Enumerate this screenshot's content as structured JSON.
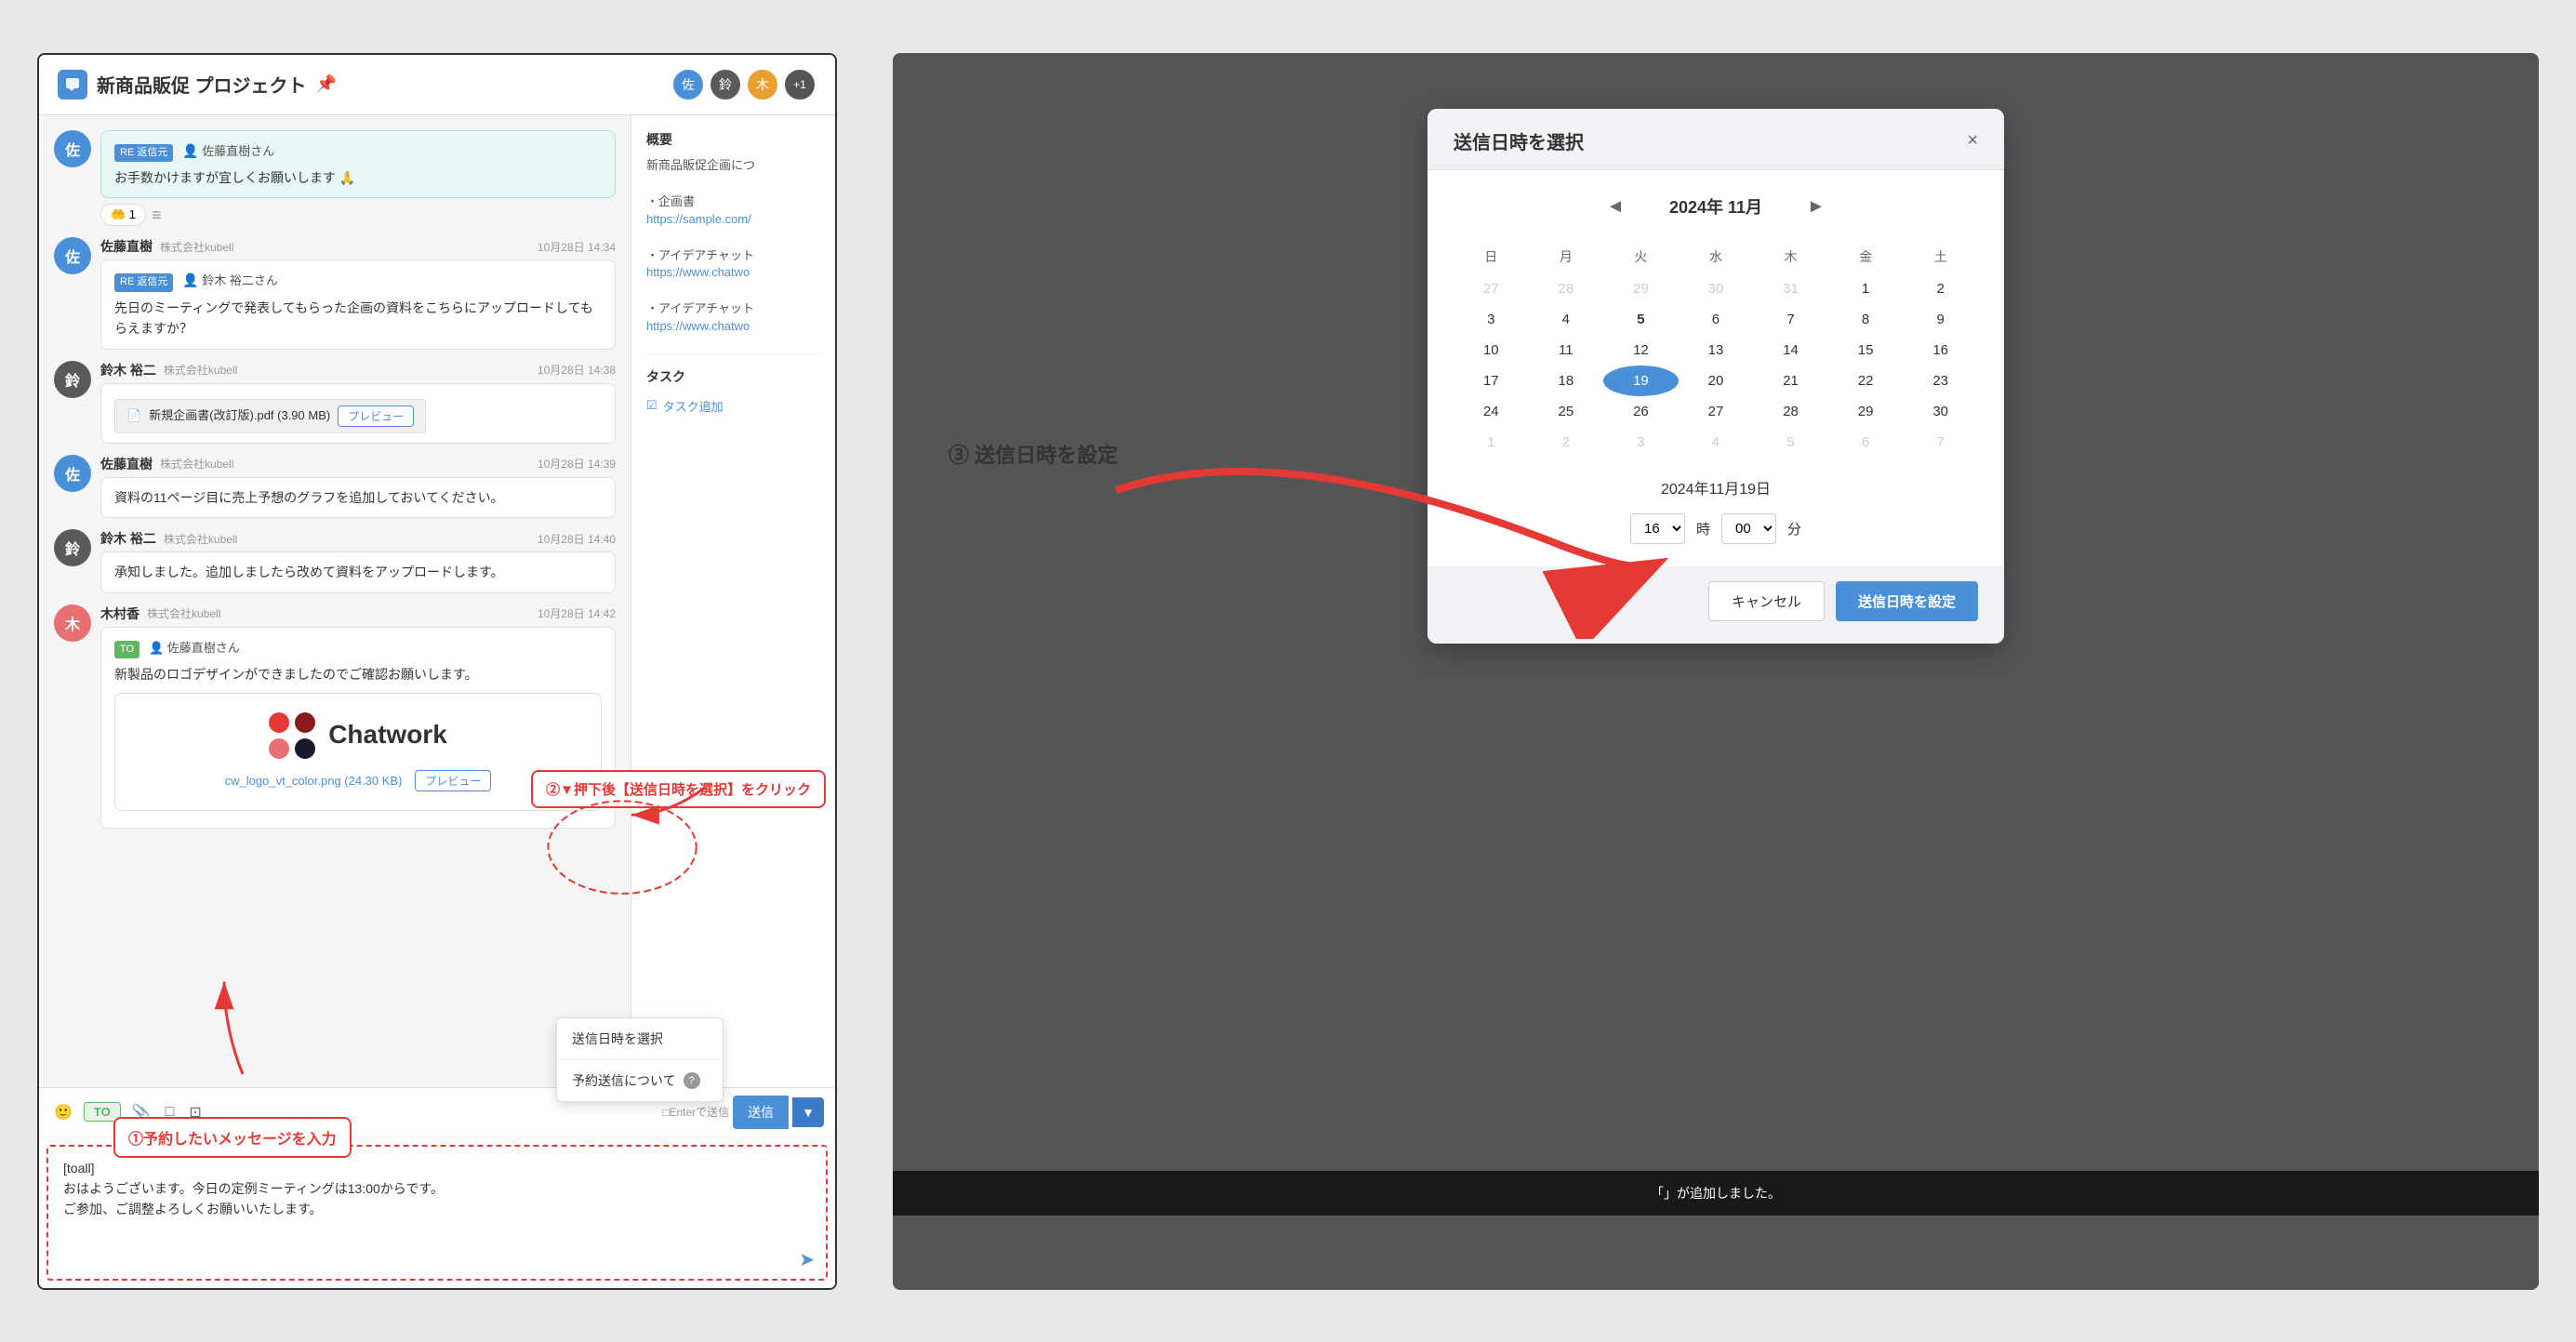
{
  "chat": {
    "title": "新商品販促 プロジェクト",
    "pin_symbol": "📌",
    "messages": [
      {
        "id": "msg1",
        "avatar_color": "#4a90d9",
        "avatar_text": "佐",
        "name": "佐藤直樹",
        "company": "株式会社kubell",
        "time": "",
        "re_tag": "RE 返信元",
        "re_person": "佐藤直樹さん",
        "body": "お手数かけますが宜しくお願いします 🙏",
        "has_reaction": true,
        "reaction_emoji": "🤲",
        "reaction_count": "1"
      },
      {
        "id": "msg2",
        "avatar_color": "#4a90d9",
        "avatar_text": "佐",
        "name": "佐藤直樹",
        "company": "株式会社kubell",
        "time": "10月28日 14:34",
        "re_tag": "RE 返信元",
        "re_person": "鈴木 裕二さん",
        "body": "先日のミーティングで発表してもらった企画の資料をこちらにアップロードしてもらえますか？"
      },
      {
        "id": "msg3",
        "avatar_color": "#5a5a5a",
        "avatar_text": "鈴",
        "name": "鈴木 裕二",
        "company": "株式会社kubell",
        "time": "10月28日 14:38",
        "body": "",
        "has_file": true,
        "file_name": "新規企画書(改訂版).pdf (3.90 MB)"
      },
      {
        "id": "msg4",
        "avatar_color": "#4a90d9",
        "avatar_text": "佐",
        "name": "佐藤直樹",
        "company": "株式会社kubell",
        "time": "10月28日 14:39",
        "body": "資料の11ページ目に売上予想のグラフを追加しておいてください。"
      },
      {
        "id": "msg5",
        "avatar_color": "#5a5a5a",
        "avatar_text": "鈴",
        "name": "鈴木 裕二",
        "company": "株式会社kubell",
        "time": "10月28日 14:40",
        "body": "承知しました。追加しましたら改めて資料をアップロードします。"
      },
      {
        "id": "msg6",
        "avatar_color": "#e87070",
        "avatar_text": "木",
        "name": "木村香",
        "company": "株式会社kubell",
        "time": "10月28日 14:42",
        "to_tag": "TO",
        "to_person": "佐藤直樹さん",
        "body": "新製品のロゴデザインができましたのでご確認お願いします。",
        "has_logo_card": true
      }
    ],
    "sidebar": {
      "overview_title": "概要",
      "overview_text": "新商品販促企画につ",
      "doc_title": "・企画書",
      "doc_link": "https://sample.com/",
      "idea_chat1_title": "・アイデアチャット",
      "idea_chat1_link": "https://www.chatwo",
      "idea_chat2_title": "・アイデアチャット",
      "idea_chat2_link": "https://www.chatwo",
      "task_title": "タスク",
      "task_add": "タスク追加"
    },
    "input": {
      "to_label": "TO",
      "send_label": "送信",
      "enter_label": "□Enterで送信",
      "textarea_value": "[toall]\nおはようございます。今日の定例ミーティングは13:00からです。\nご参加、ご調整よろしくお願いいたします。"
    },
    "dropdown": {
      "item1": "送信日時を選択",
      "item2": "予約送信について",
      "item2_icon": "?"
    },
    "annotation1": "①予約したいメッセージを入力",
    "annotation2": "②▼押下後【送信日時を選択】をクリック",
    "logo_card": {
      "filename": "cw_logo_vt_color.png (24.30 KB)",
      "preview_label": "プレビュー"
    }
  },
  "dialog": {
    "title": "送信日時を選択",
    "close_label": "×",
    "calendar": {
      "month_year": "2024年 11月",
      "prev_label": "◄",
      "next_label": "►",
      "weekdays": [
        "日",
        "月",
        "火",
        "水",
        "木",
        "金",
        "土"
      ],
      "weeks": [
        [
          "27",
          "28",
          "29",
          "30",
          "31",
          "1",
          "2"
        ],
        [
          "3",
          "4",
          "5",
          "6",
          "7",
          "8",
          "9"
        ],
        [
          "10",
          "11",
          "12",
          "13",
          "14",
          "15",
          "16"
        ],
        [
          "17",
          "18",
          "19",
          "20",
          "21",
          "22",
          "23"
        ],
        [
          "24",
          "25",
          "26",
          "27",
          "28",
          "29",
          "30"
        ],
        [
          "1",
          "2",
          "3",
          "4",
          "5",
          "6",
          "7"
        ]
      ],
      "other_month_cols_week1": [
        0,
        1,
        2,
        3,
        4
      ],
      "selected_day": "19",
      "selected_row": 3,
      "selected_col": 2,
      "bold_5_row": 1,
      "bold_5_col": 2
    },
    "selected_date_label": "2024年11月19日",
    "time": {
      "hour": "16",
      "minute": "00",
      "hour_label": "時",
      "minute_label": "分"
    },
    "cancel_label": "キャンセル",
    "set_label": "送信日時を設定"
  },
  "annotation3": "③ 送信日時を設定",
  "notification": "「」が追加しました。"
}
